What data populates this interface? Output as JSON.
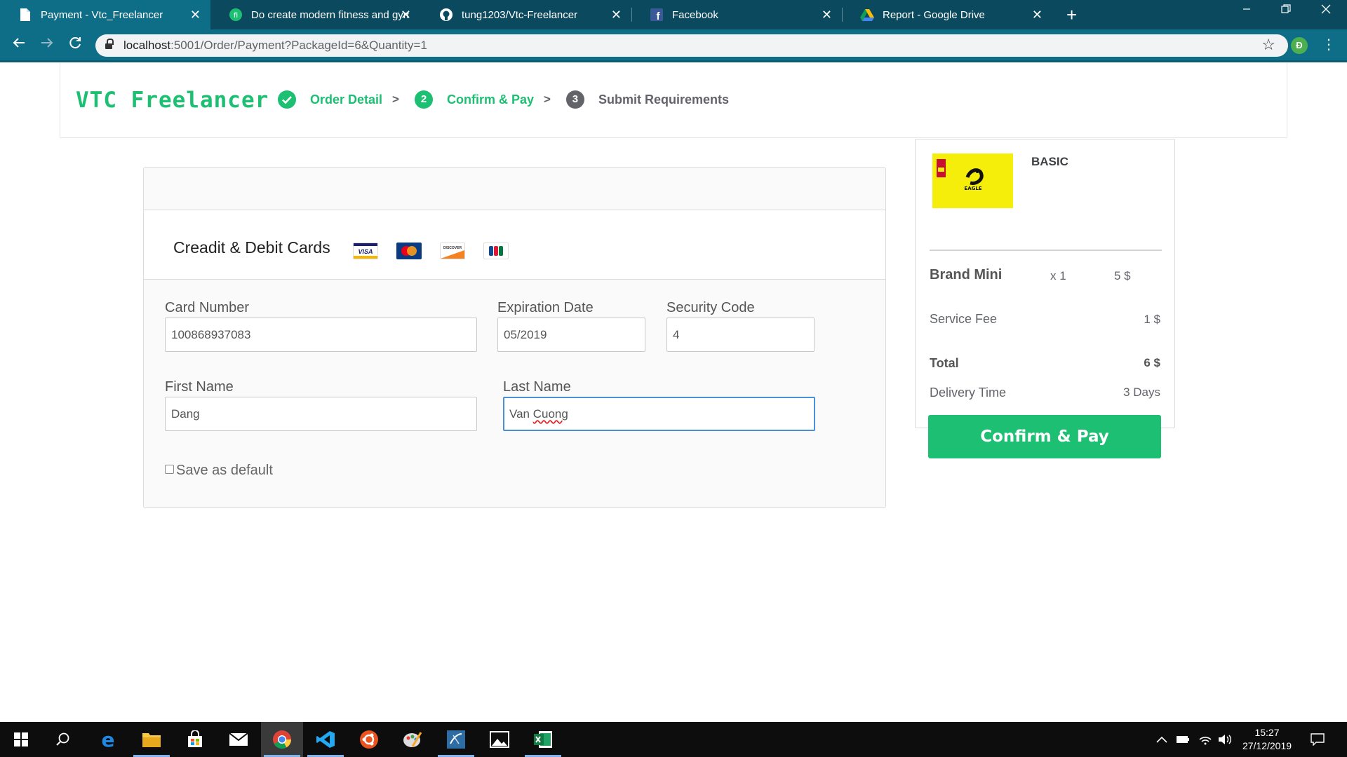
{
  "browser": {
    "tabs": [
      {
        "title": "Payment - Vtc_Freelancer",
        "active": true,
        "icon": "document-icon"
      },
      {
        "title": "Do create modern fitness and gym",
        "active": false,
        "icon": "fiverr-icon"
      },
      {
        "title": "tung1203/Vtc-Freelancer",
        "active": false,
        "icon": "github-icon"
      },
      {
        "title": "Facebook",
        "active": false,
        "icon": "facebook-icon"
      },
      {
        "title": "Report - Google Drive",
        "active": false,
        "icon": "google-drive-icon"
      }
    ],
    "close_glyph": "✕",
    "new_tab_glyph": "+",
    "url_host": "localhost",
    "url_path": ":5001/Order/Payment?PackageId=6&Quantity=1",
    "profile_initial": "Đ"
  },
  "page": {
    "logo": "VTC Freelancer",
    "steps": [
      {
        "number": "✓",
        "label": "Order Detail",
        "state": "done"
      },
      {
        "number": "2",
        "label": "Confirm & Pay",
        "state": "current"
      },
      {
        "number": "3",
        "label": "Submit Requirements",
        "state": "todo"
      }
    ],
    "step_separator": ">",
    "payment": {
      "method_title": "Creadit & Debit Cards",
      "card_brands": [
        "visa",
        "mastercard",
        "discover",
        "jcb"
      ],
      "card_number_label": "Card Number",
      "card_number_value": "100868937083",
      "expiration_label": "Expiration Date",
      "expiration_value": "05/2019",
      "security_label": "Security Code",
      "security_value": "4",
      "first_name_label": "First Name",
      "first_name_value": "Dang",
      "last_name_label": "Last Name",
      "last_name_value_1": "Van ",
      "last_name_value_2": "Cuong",
      "save_default_label": "Save as default"
    },
    "summary": {
      "package_name": "BASIC",
      "thumb_text": "EAGLE",
      "item_name": "Brand Mini",
      "item_qty": "x 1",
      "item_price": "5 $",
      "service_fee_label": "Service Fee",
      "service_fee_value": "1 $",
      "total_label": "Total",
      "total_value": "6 $",
      "delivery_label": "Delivery Time",
      "delivery_value": "3 Days",
      "confirm_button": "Confirm & Pay"
    }
  },
  "taskbar": {
    "apps": [
      "windows-start",
      "search",
      "edge",
      "file-explorer",
      "store",
      "mail",
      "chrome",
      "vscode",
      "ubuntu",
      "paint",
      "sql-server",
      "photos",
      "excel"
    ],
    "time": "15:27",
    "date": "27/12/2019"
  },
  "colors": {
    "brand_green": "#1dbf73",
    "chrome_frame": "#0b4a5e",
    "chrome_toolbar": "#0f6e87"
  }
}
